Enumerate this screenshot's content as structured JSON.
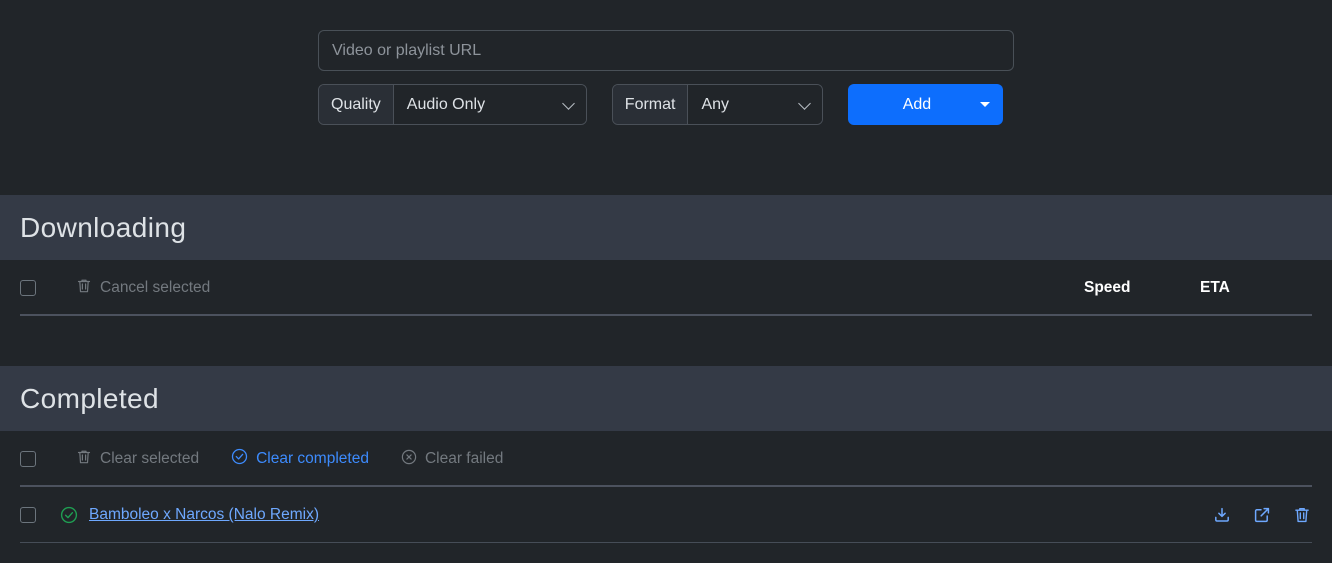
{
  "add_form": {
    "url_placeholder": "Video or playlist URL",
    "url_value": "",
    "quality_label": "Quality",
    "quality_value": "Audio Only",
    "format_label": "Format",
    "format_value": "Any",
    "add_label": "Add"
  },
  "downloading": {
    "title": "Downloading",
    "toolbar": {
      "cancel_selected": "Cancel selected"
    },
    "columns": {
      "speed": "Speed",
      "eta": "ETA"
    },
    "rows": []
  },
  "completed": {
    "title": "Completed",
    "toolbar": {
      "clear_selected": "Clear selected",
      "clear_completed": "Clear completed",
      "clear_failed": "Clear failed"
    },
    "rows": [
      {
        "title": "Bamboleo x Narcos (Nalo Remix)",
        "status": "completed"
      }
    ]
  },
  "colors": {
    "page_bg": "#212529",
    "section_header_bg": "#343a46",
    "primary": "#0d6efd",
    "link": "#6ea8fe",
    "active_action": "#3d8bfd",
    "muted_text": "#73797f",
    "success_green": "#1f9e52"
  }
}
